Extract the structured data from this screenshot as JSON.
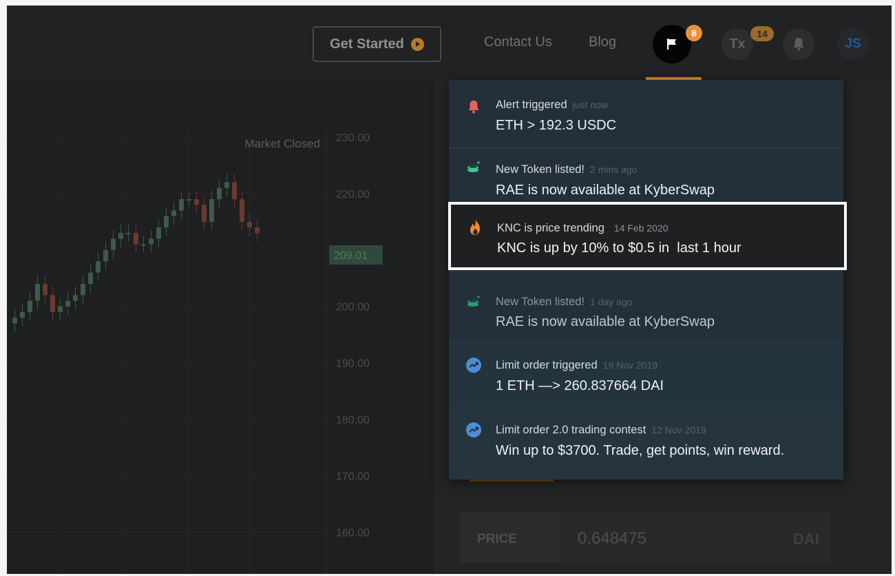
{
  "header": {
    "get_started_label": "Get Started",
    "contact_label": "Contact Us",
    "blog_label": "Blog",
    "notifications_count": "8",
    "tx_label": "Tx",
    "tx_count": "14",
    "avatar_initials": "JS"
  },
  "chart": {
    "market_status": "Market Closed",
    "current_price": "209.01",
    "y_ticks": [
      "230.00",
      "220.00",
      "200.00",
      "190.00",
      "180.00",
      "170.00",
      "160.00"
    ]
  },
  "notifications": [
    {
      "title": "Alert triggered",
      "time": "just now",
      "body": "ETH > 192.3 USDC",
      "icon": "bell-icon",
      "color": "#e5645b"
    },
    {
      "title": "New Token listed!",
      "time": "2 mins ago",
      "body": "RAE is now available at KyberSwap",
      "icon": "new-token-icon",
      "color": "#3cc58f"
    },
    {
      "title": "KNC is price trending",
      "time": "14 Feb 2020",
      "body": "KNC is up by 10% to $0.5 in  last 1 hour",
      "icon": "fire-icon",
      "color": "#f28a2e"
    },
    {
      "title": "New Token listed!",
      "time": "1 day ago",
      "body": "RAE is now available at KyberSwap",
      "icon": "new-token-icon",
      "color": "#3cc58f"
    },
    {
      "title": "Limit order triggered",
      "time": "19 Nov 2019",
      "body": "1 ETH —> 260.837664 DAI",
      "icon": "trending-up-icon",
      "color": "#4a8fd6"
    },
    {
      "title": "Limit order 2.0 trading contest",
      "time": "12 Nov 2019",
      "body": "Win up to $3700. Trade, get points, win reward.",
      "icon": "trending-up-icon",
      "color": "#4a8fd6"
    }
  ],
  "order_form": {
    "price_label": "PRICE",
    "price_value": "0.648475",
    "price_unit": "DAI"
  },
  "colors": {
    "accent": "#d9892a",
    "up_candle": "#3d5a4d",
    "down_candle": "#6a3a32"
  }
}
